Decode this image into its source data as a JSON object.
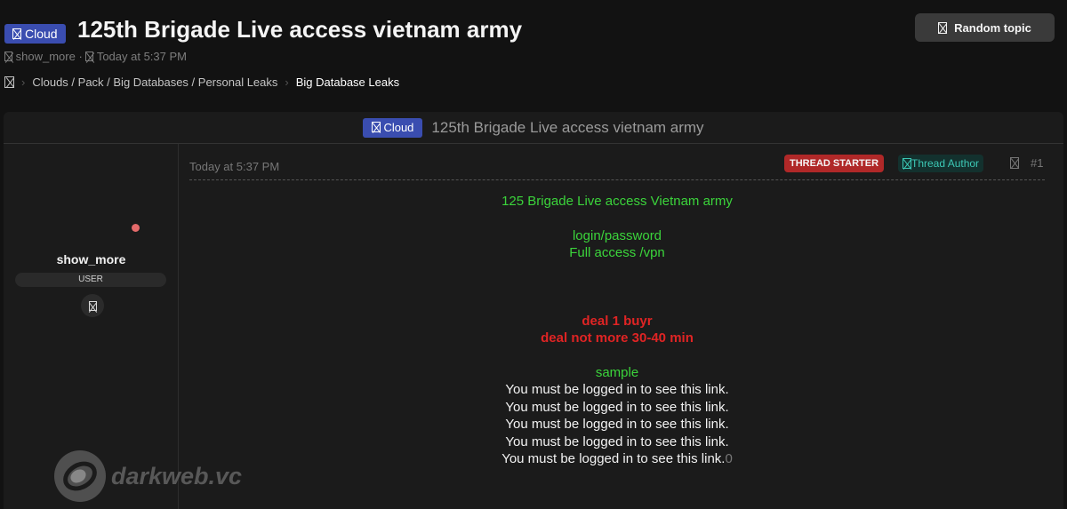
{
  "thread": {
    "prefix": "Cloud",
    "title": "125th Brigade Live access vietnam army",
    "author": "show_more",
    "date": "Today at 5:37 PM",
    "meta_sep": "·"
  },
  "header": {
    "random_label": "Random topic"
  },
  "breadcrumb": {
    "items": [
      "Clouds / Pack / Big Databases / Personal Leaks",
      "Big Database Leaks"
    ],
    "sep": "›"
  },
  "user": {
    "name": "show_more",
    "role": "USER",
    "online_color": "#e56b6b"
  },
  "post": {
    "date": "Today at 5:37 PM",
    "starter_badge": "THREAD STARTER",
    "author_badge": "Thread Author",
    "number": "#1",
    "lines": {
      "l1": "125 Brigade Live access Vietnam army",
      "l2": "login/password",
      "l3": "Full access /vpn",
      "l4": "deal 1 buyr",
      "l5": "deal not more 30-40 min",
      "l6": "sample",
      "link_msg": "You must be logged in to see this link.",
      "trail": "0"
    }
  },
  "watermark": {
    "text": "darkweb.vc"
  },
  "colors": {
    "prefix_bg": "#3a4db0",
    "green_text": "#3bd43b",
    "red_text": "#e02424",
    "starter_bg": "#b02828",
    "author_fg": "#3cc8b5"
  },
  "icons": [
    "missing-glyph-icon",
    "online-status-dot",
    "darkweb-logo-icon"
  ]
}
